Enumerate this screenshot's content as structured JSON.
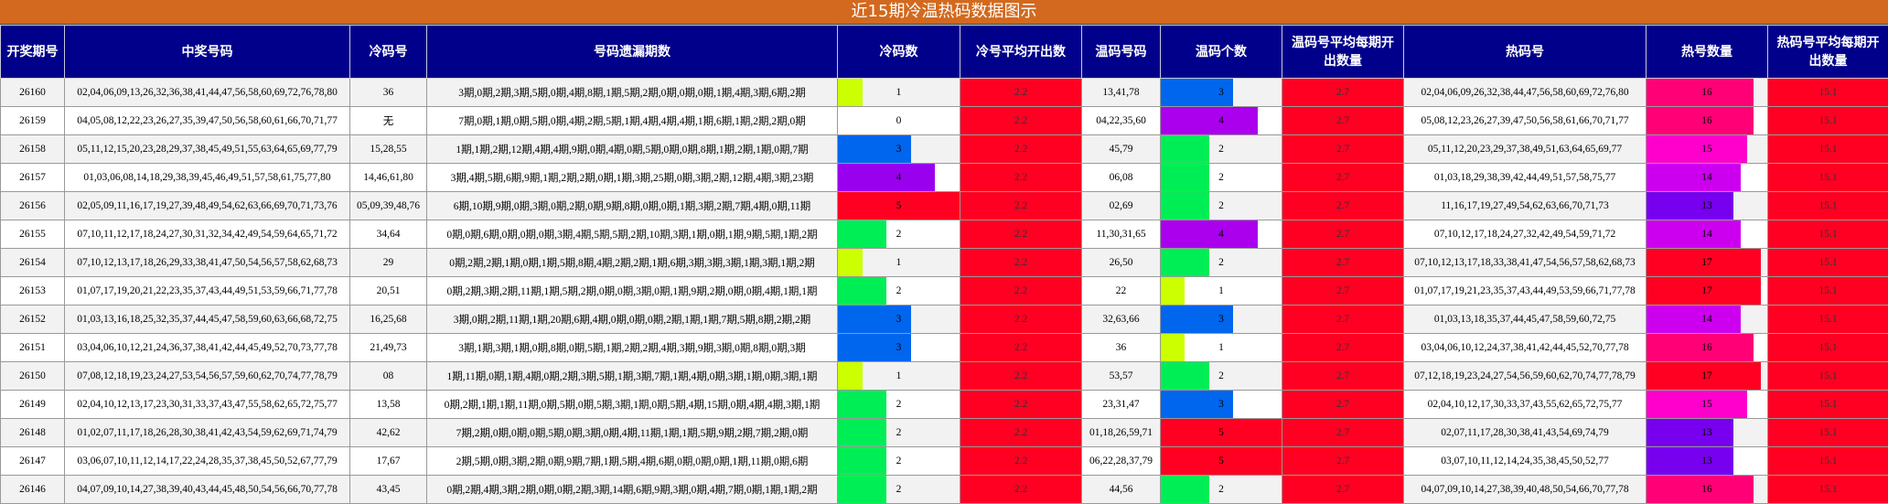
{
  "title": "近15期冷温热码数据图示",
  "headers": [
    "开奖期号",
    "中奖号码",
    "冷码号",
    "号码遗漏期数",
    "冷码数",
    "冷号平均开出数",
    "温码号码",
    "温码个数",
    "温码号平均每期开出数量",
    "热码号",
    "热号数量",
    "热码号平均每期开出数量"
  ],
  "cold_avg": "2.2",
  "warm_avg": "2.7",
  "hot_avg": "15.1",
  "colors": {
    "cold": {
      "0": "#ffffff",
      "1": "#ccff00",
      "2": "#00ee55",
      "3": "#0066ee",
      "4": "#9900ee",
      "5": "#ff0022"
    },
    "warm": {
      "1": "#ccff00",
      "2": "#00ee55",
      "3": "#0066ee",
      "4": "#aa00ee",
      "5": "#ff0022"
    },
    "hot": {
      "13": "#7700ee",
      "14": "#cc00ee",
      "15": "#ff00cc",
      "16": "#ff0077",
      "17": "#ff0022",
      "18": "#ff0055"
    }
  },
  "rows": [
    {
      "issue": "26160",
      "numbers": "02,04,06,09,13,26,32,36,38,41,44,47,56,58,60,69,72,76,78,80",
      "cold_nums": "36",
      "miss": "3期,0期,2期,3期,5期,0期,4期,8期,1期,5期,2期,0期,0期,0期,1期,4期,3期,6期,2期",
      "cold_count": "1",
      "warm_nums": "13,41,78",
      "warm_count": "3",
      "hot_nums": "02,04,06,09,26,32,38,44,47,56,58,60,69,72,76,80",
      "hot_count": "16"
    },
    {
      "issue": "26159",
      "numbers": "04,05,08,12,22,23,26,27,35,39,47,50,56,58,60,61,66,70,71,77",
      "cold_nums": "无",
      "miss": "7期,0期,1期,0期,5期,0期,4期,2期,5期,1期,4期,4期,4期,1期,6期,1期,2期,2期,0期",
      "cold_count": "0",
      "warm_nums": "04,22,35,60",
      "warm_count": "4",
      "hot_nums": "05,08,12,23,26,27,39,47,50,56,58,61,66,70,71,77",
      "hot_count": "16"
    },
    {
      "issue": "26158",
      "numbers": "05,11,12,15,20,23,28,29,37,38,45,49,51,55,63,64,65,69,77,79",
      "cold_nums": "15,28,55",
      "miss": "1期,1期,2期,12期,4期,4期,9期,0期,4期,0期,5期,0期,0期,8期,1期,2期,1期,0期,7期",
      "cold_count": "3",
      "warm_nums": "45,79",
      "warm_count": "2",
      "hot_nums": "05,11,12,20,23,29,37,38,49,51,63,64,65,69,77",
      "hot_count": "15"
    },
    {
      "issue": "26157",
      "numbers": "01,03,06,08,14,18,29,38,39,45,46,49,51,57,58,61,75,77,80",
      "cold_nums": "14,46,61,80",
      "miss": "3期,4期,5期,6期,9期,1期,2期,2期,0期,1期,3期,25期,0期,3期,2期,12期,4期,3期,23期",
      "cold_count": "4",
      "warm_nums": "06,08",
      "warm_count": "2",
      "hot_nums": "01,03,18,29,38,39,42,44,49,51,57,58,75,77",
      "hot_count": "14"
    },
    {
      "issue": "26156",
      "numbers": "02,05,09,11,16,17,19,27,39,48,49,54,62,63,66,69,70,71,73,76",
      "cold_nums": "05,09,39,48,76",
      "miss": "6期,10期,9期,0期,3期,0期,2期,0期,9期,8期,0期,0期,1期,3期,2期,7期,4期,0期,11期",
      "cold_count": "5",
      "warm_nums": "02,69",
      "warm_count": "2",
      "hot_nums": "11,16,17,19,27,49,54,62,63,66,70,71,73",
      "hot_count": "13"
    },
    {
      "issue": "26155",
      "numbers": "07,10,11,12,17,18,24,27,30,31,32,34,42,49,54,59,64,65,71,72",
      "cold_nums": "34,64",
      "miss": "0期,0期,6期,0期,0期,0期,3期,4期,5期,5期,2期,10期,3期,1期,0期,1期,9期,5期,1期,2期",
      "cold_count": "2",
      "warm_nums": "11,30,31,65",
      "warm_count": "4",
      "hot_nums": "07,10,12,17,18,24,27,32,42,49,54,59,71,72",
      "hot_count": "14"
    },
    {
      "issue": "26154",
      "numbers": "07,10,12,13,17,18,26,29,33,38,41,47,50,54,56,57,58,62,68,73",
      "cold_nums": "29",
      "miss": "0期,2期,2期,1期,0期,1期,5期,8期,4期,2期,2期,1期,6期,3期,3期,3期,1期,3期,1期,2期",
      "cold_count": "1",
      "warm_nums": "26,50",
      "warm_count": "2",
      "hot_nums": "07,10,12,13,17,18,33,38,41,47,54,56,57,58,62,68,73",
      "hot_count": "17"
    },
    {
      "issue": "26153",
      "numbers": "01,07,17,19,20,21,22,23,35,37,43,44,49,51,53,59,66,71,77,78",
      "cold_nums": "20,51",
      "miss": "0期,2期,3期,2期,11期,1期,5期,2期,0期,0期,3期,0期,1期,9期,2期,0期,0期,4期,1期,1期",
      "cold_count": "2",
      "warm_nums": "22",
      "warm_count": "1",
      "hot_nums": "01,07,17,19,21,23,35,37,43,44,49,53,59,66,71,77,78",
      "hot_count": "17"
    },
    {
      "issue": "26152",
      "numbers": "01,03,13,16,18,25,32,35,37,44,45,47,58,59,60,63,66,68,72,75",
      "cold_nums": "16,25,68",
      "miss": "3期,0期,2期,11期,1期,20期,6期,4期,0期,0期,0期,2期,1期,1期,7期,5期,8期,2期,2期",
      "cold_count": "3",
      "warm_nums": "32,63,66",
      "warm_count": "3",
      "hot_nums": "01,03,13,18,35,37,44,45,47,58,59,60,72,75",
      "hot_count": "14"
    },
    {
      "issue": "26151",
      "numbers": "03,04,06,10,12,21,24,36,37,38,41,42,44,45,49,52,70,73,77,78",
      "cold_nums": "21,49,73",
      "miss": "3期,1期,3期,1期,0期,8期,0期,5期,1期,2期,2期,4期,3期,9期,3期,0期,8期,0期,3期",
      "cold_count": "3",
      "warm_nums": "36",
      "warm_count": "1",
      "hot_nums": "03,04,06,10,12,24,37,38,41,42,44,45,52,70,77,78",
      "hot_count": "16"
    },
    {
      "issue": "26150",
      "numbers": "07,08,12,18,19,23,24,27,53,54,56,57,59,60,62,70,74,77,78,79",
      "cold_nums": "08",
      "miss": "1期,11期,0期,1期,4期,0期,2期,3期,5期,1期,3期,7期,1期,4期,0期,3期,1期,0期,3期,1期",
      "cold_count": "1",
      "warm_nums": "53,57",
      "warm_count": "2",
      "hot_nums": "07,12,18,19,23,24,27,54,56,59,60,62,70,74,77,78,79",
      "hot_count": "17"
    },
    {
      "issue": "26149",
      "numbers": "02,04,10,12,13,17,23,30,31,33,37,43,47,55,58,62,65,72,75,77",
      "cold_nums": "13,58",
      "miss": "0期,2期,1期,1期,11期,0期,5期,0期,5期,3期,1期,0期,5期,4期,15期,0期,4期,4期,3期,1期",
      "cold_count": "2",
      "warm_nums": "23,31,47",
      "warm_count": "3",
      "hot_nums": "02,04,10,12,17,30,33,37,43,55,62,65,72,75,77",
      "hot_count": "15"
    },
    {
      "issue": "26148",
      "numbers": "01,02,07,11,17,18,26,28,30,38,41,42,43,54,59,62,69,71,74,79",
      "cold_nums": "42,62",
      "miss": "7期,2期,0期,0期,0期,5期,0期,3期,0期,4期,11期,1期,1期,5期,9期,2期,7期,2期,0期",
      "cold_count": "2",
      "warm_nums": "01,18,26,59,71",
      "warm_count": "5",
      "hot_nums": "02,07,11,17,28,30,38,41,43,54,69,74,79",
      "hot_count": "13"
    },
    {
      "issue": "26147",
      "numbers": "03,06,07,10,11,12,14,17,22,24,28,35,37,38,45,50,52,67,77,79",
      "cold_nums": "17,67",
      "miss": "2期,5期,0期,3期,2期,0期,9期,7期,1期,5期,4期,6期,0期,0期,0期,1期,11期,0期,6期",
      "cold_count": "2",
      "warm_nums": "06,22,28,37,79",
      "warm_count": "5",
      "hot_nums": "03,07,10,11,12,14,24,35,38,45,50,52,77",
      "hot_count": "13"
    },
    {
      "issue": "26146",
      "numbers": "04,07,09,10,14,27,38,39,40,43,44,45,48,50,54,56,66,70,77,78",
      "cold_nums": "43,45",
      "miss": "0期,2期,4期,3期,2期,0期,0期,2期,3期,14期,6期,9期,3期,0期,4期,7期,0期,1期,1期,2期",
      "cold_count": "2",
      "warm_nums": "44,56",
      "warm_count": "2",
      "hot_nums": "04,07,09,10,14,27,38,39,40,48,50,54,66,70,77,78",
      "hot_count": "16"
    }
  ]
}
